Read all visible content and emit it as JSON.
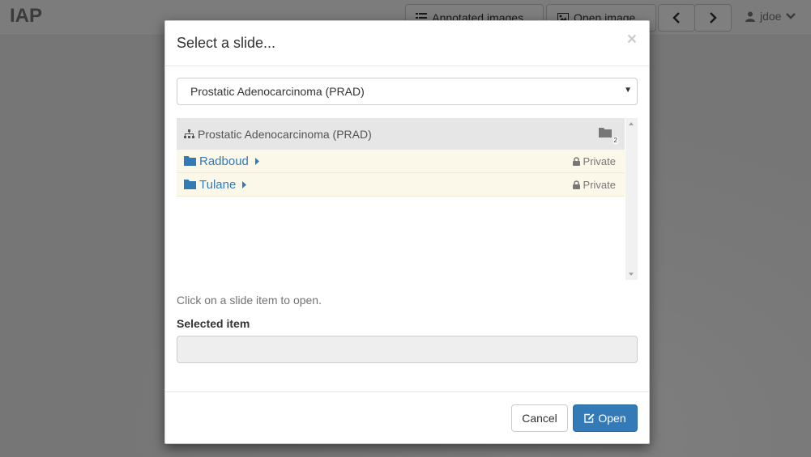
{
  "navbar": {
    "brand": "IAP",
    "annotated_images_label": "Annotated images...",
    "open_image_label": "Open image...",
    "prev_icon": "chevron-left-icon",
    "next_icon": "chevron-right-icon",
    "user_name": "jdoe"
  },
  "dialog": {
    "title": "Select a slide...",
    "close_symbol": "×",
    "collection_select": {
      "selected": "Prostatic Adenocarcinoma (PRAD)"
    },
    "tree": {
      "root_label": "Prostatic Adenocarcinoma (PRAD)",
      "root_folder_count": "2",
      "folders": [
        {
          "name": "Radboud",
          "access": "Private"
        },
        {
          "name": "Tulane",
          "access": "Private"
        }
      ]
    },
    "help_text": "Click on a slide item to open.",
    "selected_item_label": "Selected item",
    "selected_item_value": "",
    "cancel_label": "Cancel",
    "open_label": "Open"
  },
  "colors": {
    "primary": "#337ab7",
    "folder_row_bg": "#fcf8e9",
    "tree_header_bg": "#e6e6e6"
  }
}
